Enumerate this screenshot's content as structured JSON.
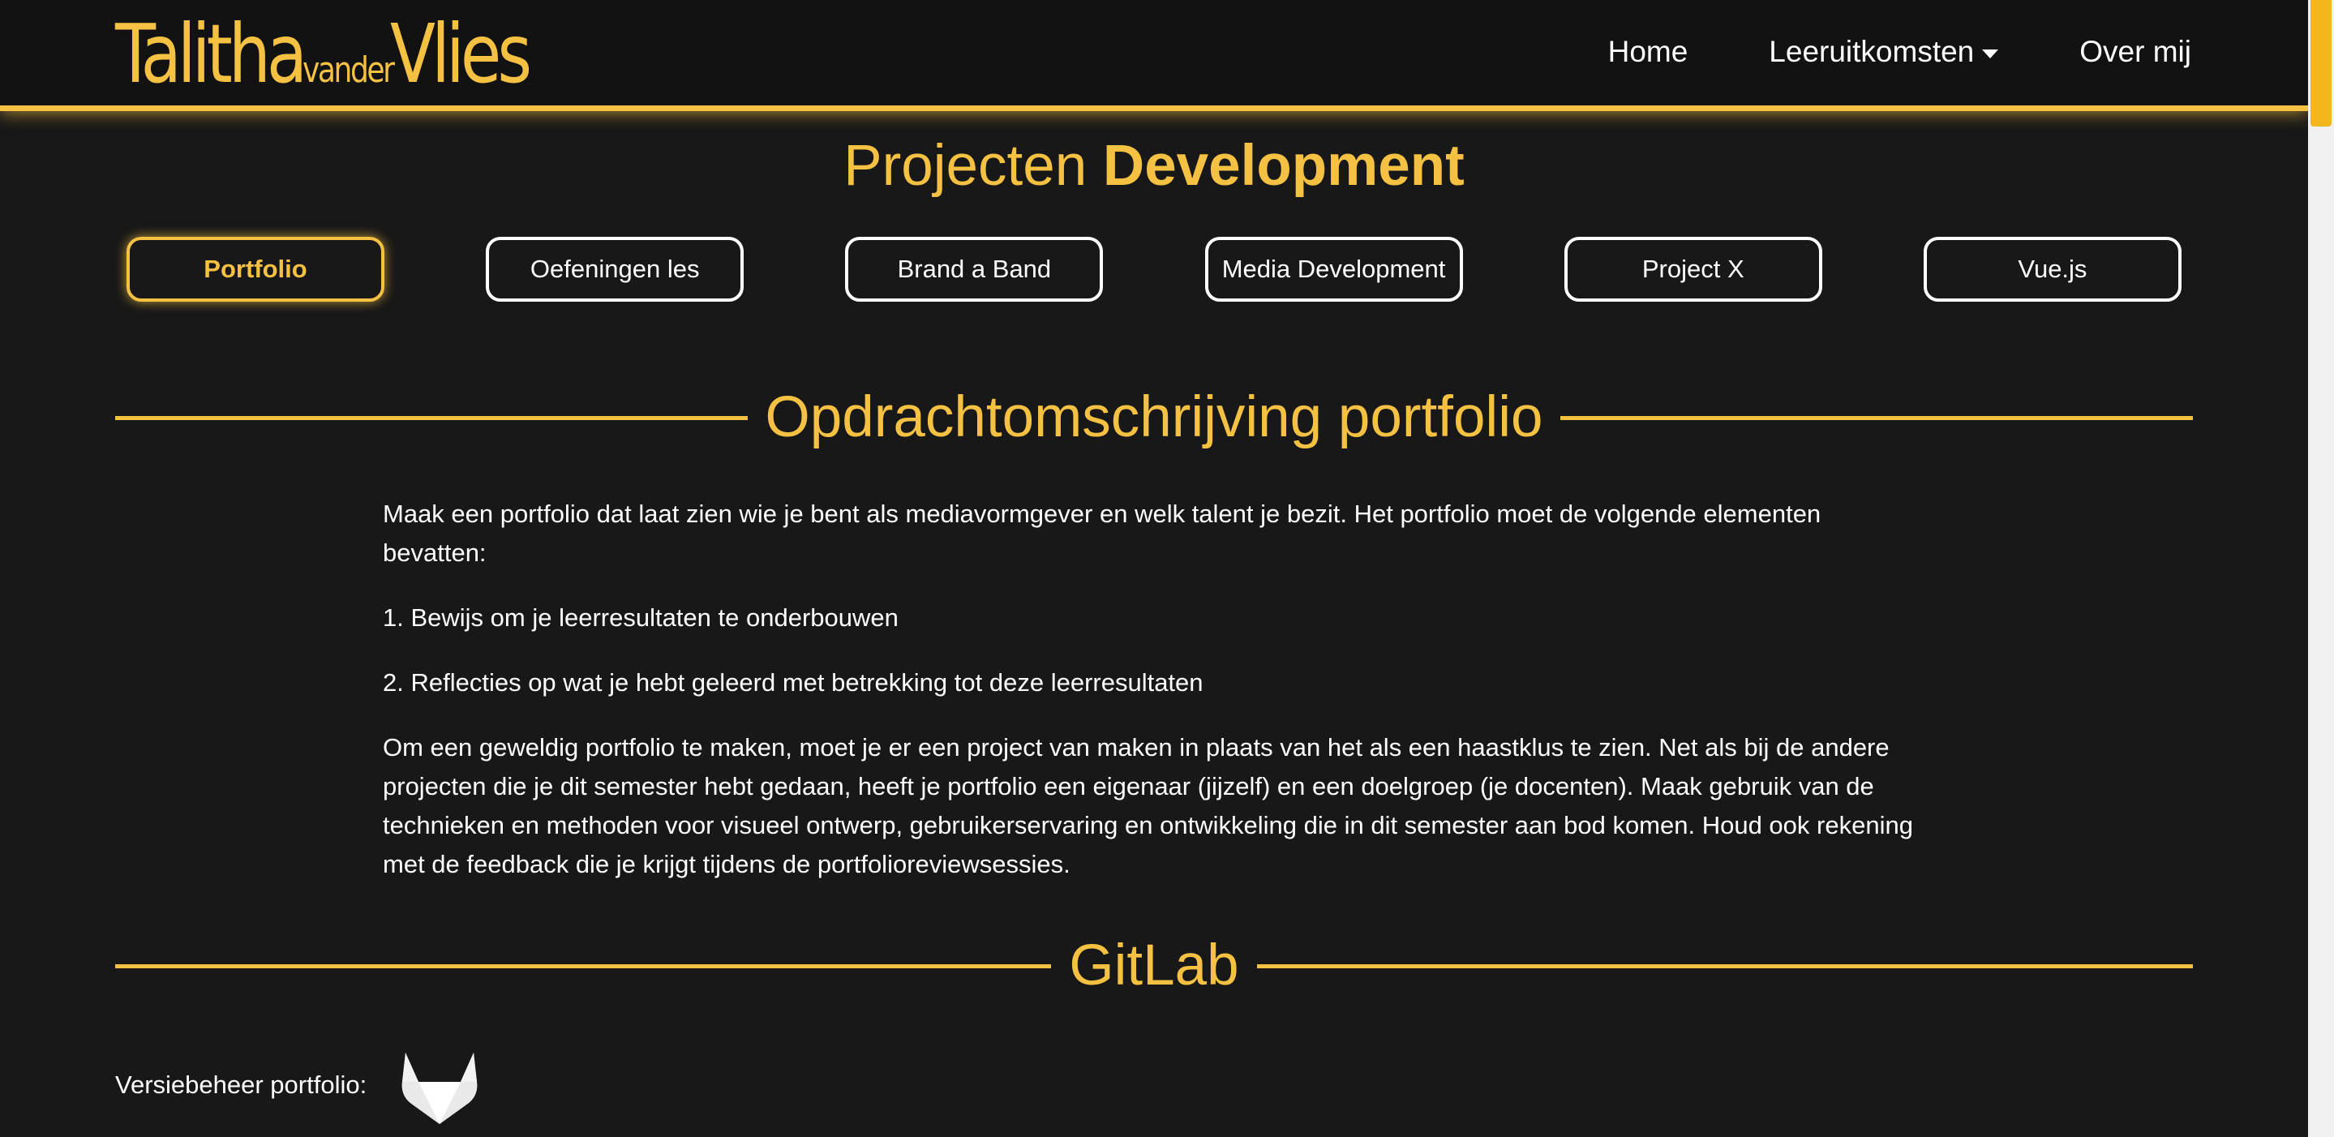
{
  "header": {
    "logo": {
      "part1": "Talitha",
      "part2": "vander",
      "part3": "Vlies"
    },
    "nav": [
      {
        "label": "Home"
      },
      {
        "label": "Leeruitkomsten"
      },
      {
        "label": "Over mij"
      }
    ]
  },
  "main": {
    "title_normal": "Projecten",
    "title_bold": "Development",
    "tabs": [
      {
        "label": "Portfolio",
        "active": true
      },
      {
        "label": "Oefeningen les"
      },
      {
        "label": "Brand a Band"
      },
      {
        "label": "Media Development"
      },
      {
        "label": "Project X"
      },
      {
        "label": "Vue.js"
      }
    ],
    "section1": {
      "heading": "Opdrachtomschrijving portfolio",
      "paragraphs": [
        "Maak een portfolio dat laat zien wie je bent als mediavormgever en welk talent je bezit. Het portfolio moet de volgende elementen bevatten:",
        "1. Bewijs om je leerresultaten te onderbouwen",
        "2. Reflecties op wat je hebt geleerd met betrekking tot deze leerresultaten",
        "Om een geweldig portfolio te maken, moet je er een project van maken in plaats van het als een haastklus te zien. Net als bij de andere projecten die je dit semester hebt gedaan, heeft je portfolio een eigenaar (jijzelf) en een doelgroep (je docenten). Maak gebruik van de technieken en methoden voor visueel ontwerp, gebruikerservaring en ontwikkeling die in dit semester aan bod komen. Houd ook rekening met de feedback die je krijgt tijdens de portfolioreviewsessies."
      ]
    },
    "section2": {
      "heading": "GitLab",
      "version_label": "Versiebeheer portfolio:",
      "icon": "gitlab-icon"
    }
  },
  "colors": {
    "accent": "#f5c142",
    "background": "#181818",
    "header_background": "#121212",
    "text": "#ffffff"
  }
}
